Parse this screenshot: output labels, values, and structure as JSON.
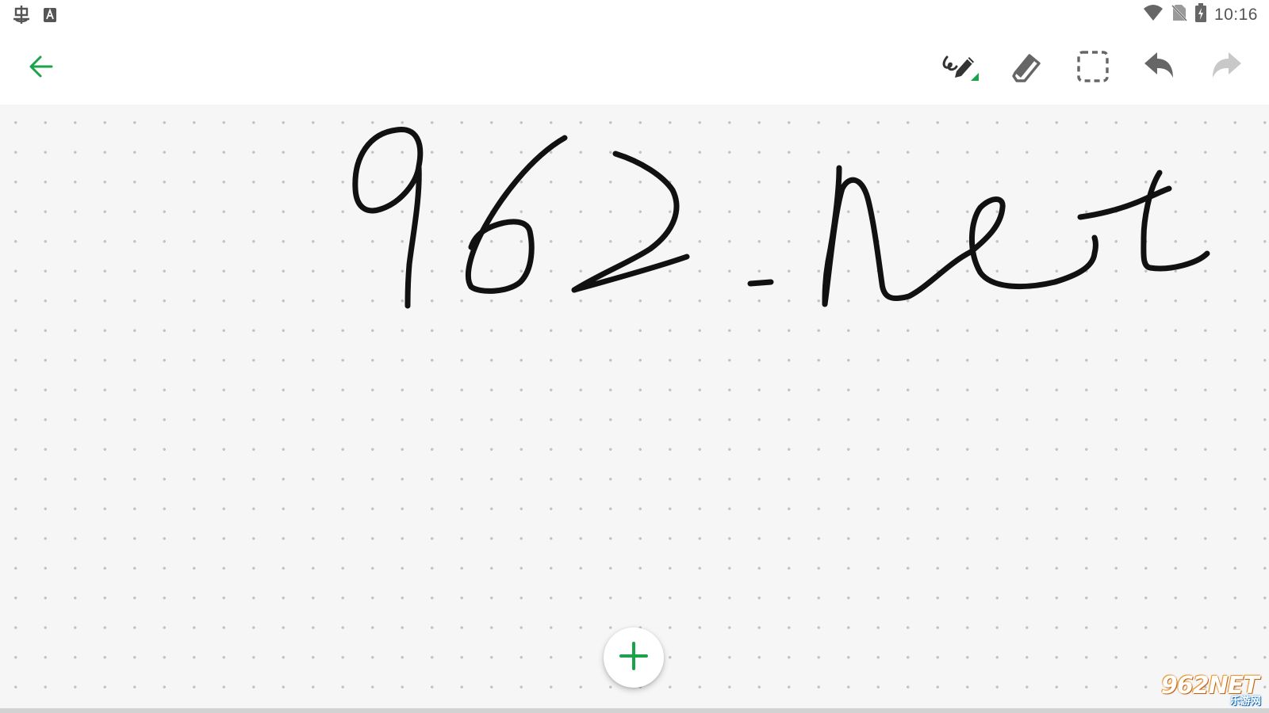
{
  "status_bar": {
    "time": "10:16",
    "icons": [
      "bug-icon",
      "keyboard-a-icon",
      "wifi-icon",
      "no-sim-icon",
      "battery-charging-icon"
    ]
  },
  "toolbar": {
    "back_icon": "arrow-left-icon",
    "tools": [
      "pen-icon",
      "eraser-icon",
      "lasso-select-icon",
      "undo-icon",
      "redo-icon"
    ]
  },
  "canvas": {
    "background": "dot-grid",
    "handwriting": "962.Net"
  },
  "fab": {
    "icon": "plus-icon"
  },
  "watermark": {
    "main": "962NET",
    "sub": "乐游网"
  },
  "colors": {
    "accent": "#1aa34a",
    "ink": "#111111",
    "icon_gray": "#666666",
    "icon_disabled": "#c8c8c8"
  }
}
